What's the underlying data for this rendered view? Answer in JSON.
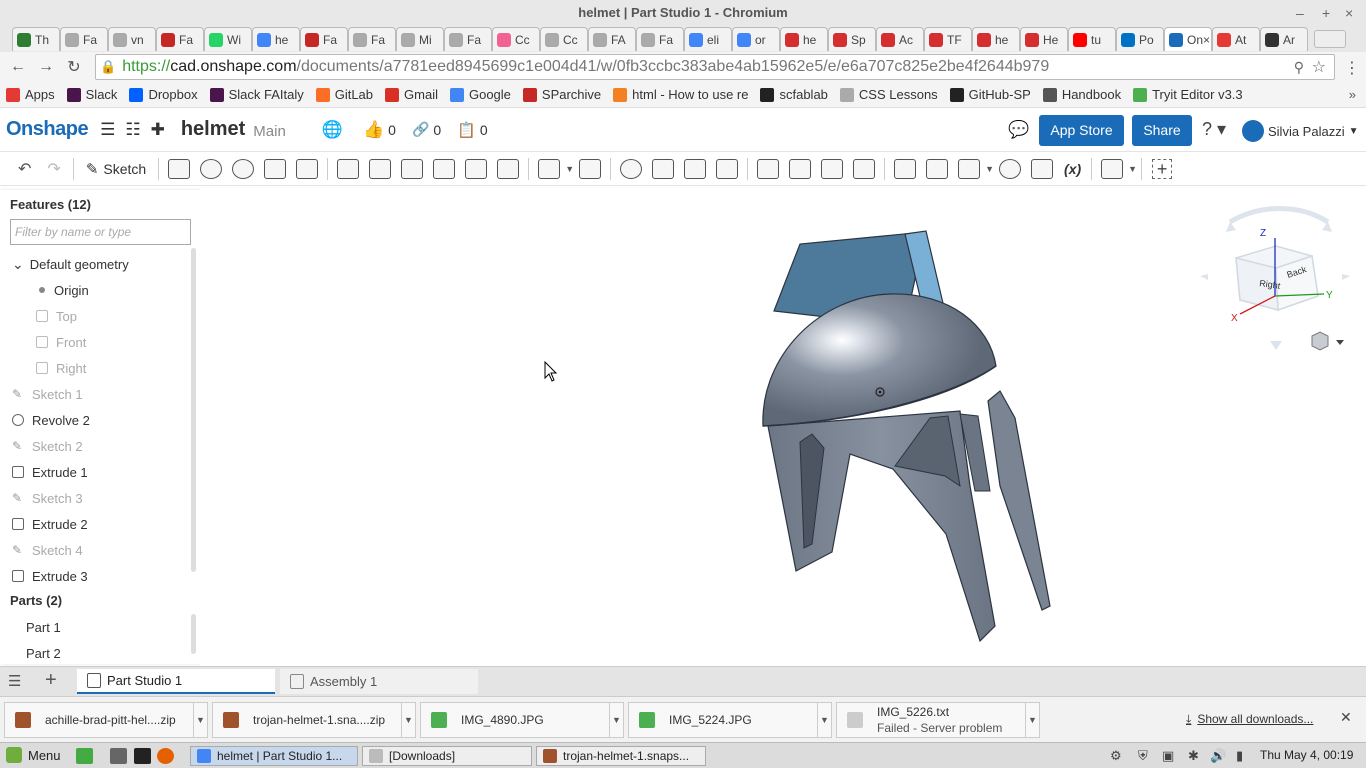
{
  "window": {
    "title": "helmet | Part Studio 1 - Chromium"
  },
  "browser": {
    "tabs": [
      {
        "label": "Th",
        "icon_color": "#2e7d32",
        "icon": "facebook-icon"
      },
      {
        "label": "Fa",
        "icon_color": "#aaaaaa",
        "icon": "page-icon"
      },
      {
        "label": "vn",
        "icon_color": "#aaaaaa",
        "icon": "page-icon"
      },
      {
        "label": "Fa",
        "icon_color": "#c62828",
        "icon": "fablab-icon"
      },
      {
        "label": "Wi",
        "icon_color": "#25d366",
        "icon": "whatsapp-icon"
      },
      {
        "label": "he",
        "icon_color": "#4285f4",
        "icon": "google-icon"
      },
      {
        "label": "Fa",
        "icon_color": "#c62828",
        "icon": "fablab-icon"
      },
      {
        "label": "Fa",
        "icon_color": "#aaaaaa",
        "icon": "page-icon"
      },
      {
        "label": "Mi",
        "icon_color": "#aaaaaa",
        "icon": "page-icon"
      },
      {
        "label": "Fa",
        "icon_color": "#aaaaaa",
        "icon": "page-icon"
      },
      {
        "label": "Cc",
        "icon_color": "#f06292",
        "icon": "dots-icon"
      },
      {
        "label": "Cc",
        "icon_color": "#aaaaaa",
        "icon": "page-icon"
      },
      {
        "label": "FA",
        "icon_color": "#aaaaaa",
        "icon": "page-icon"
      },
      {
        "label": "Fa",
        "icon_color": "#aaaaaa",
        "icon": "page-icon"
      },
      {
        "label": "eli",
        "icon_color": "#4285f4",
        "icon": "google-icon"
      },
      {
        "label": "or",
        "icon_color": "#4285f4",
        "icon": "google-icon"
      },
      {
        "label": "he",
        "icon_color": "#d32f2f",
        "icon": "gc-icon"
      },
      {
        "label": "Sp",
        "icon_color": "#d32f2f",
        "icon": "gc-icon"
      },
      {
        "label": "Ac",
        "icon_color": "#d32f2f",
        "icon": "gc-icon"
      },
      {
        "label": "TF",
        "icon_color": "#d32f2f",
        "icon": "gc-icon"
      },
      {
        "label": "he",
        "icon_color": "#d32f2f",
        "icon": "gc-icon"
      },
      {
        "label": "He",
        "icon_color": "#d32f2f",
        "icon": "gc-icon"
      },
      {
        "label": "tu",
        "icon_color": "#ff0000",
        "icon": "youtube-icon"
      },
      {
        "label": "Po",
        "icon_color": "#0072c6",
        "icon": "outlook-icon"
      },
      {
        "label": "On",
        "icon_color": "#1a6bb8",
        "icon": "onshape-icon",
        "active": true
      },
      {
        "label": "At",
        "icon_color": "#e53935",
        "icon": "tool-icon"
      },
      {
        "label": "Ar",
        "icon_color": "#333333",
        "icon": "amazon-icon"
      }
    ],
    "url": {
      "scheme": "https://",
      "host": "cad.onshape.com",
      "path": "/documents/a7781eed8945699c1e004d41/w/0fb3ccbc383abe4ab15962e5/e/e6a707c825e2be4f2644b979"
    },
    "bookmarks": [
      {
        "label": "Apps",
        "icon_color": "#e53935"
      },
      {
        "label": "Slack",
        "icon_color": "#4a154b"
      },
      {
        "label": "Dropbox",
        "icon_color": "#0061ff"
      },
      {
        "label": "Slack FAItaly",
        "icon_color": "#4a154b"
      },
      {
        "label": "GitLab",
        "icon_color": "#fc6d26"
      },
      {
        "label": "Gmail",
        "icon_color": "#d93025"
      },
      {
        "label": "Google",
        "icon_color": "#4285f4"
      },
      {
        "label": "SParchive",
        "icon_color": "#c62828"
      },
      {
        "label": "html - How to use re",
        "icon_color": "#f48024"
      },
      {
        "label": "scfablab",
        "icon_color": "#222222"
      },
      {
        "label": "CSS Lessons",
        "icon_color": "#aaaaaa"
      },
      {
        "label": "GitHub-SP",
        "icon_color": "#222222"
      },
      {
        "label": "Handbook",
        "icon_color": "#555555"
      },
      {
        "label": "Tryit Editor v3.3",
        "icon_color": "#4caf50"
      }
    ]
  },
  "app": {
    "logo": "Onshape",
    "doc_title": "helmet",
    "branch": "Main",
    "likes": "0",
    "links": "0",
    "copies": "0",
    "app_store_label": "App Store",
    "share_label": "Share",
    "user_name": "Silvia Palazzi",
    "accent": "#1a6bb8"
  },
  "toolbar": {
    "sketch_label": "Sketch",
    "variable_label": "(x)"
  },
  "features": {
    "title": "Features (12)",
    "filter_placeholder": "Filter by name or type",
    "items": [
      {
        "label": "Default geometry",
        "kind": "group",
        "dim": false
      },
      {
        "label": "Origin",
        "kind": "origin",
        "dim": false
      },
      {
        "label": "Top",
        "kind": "plane",
        "dim": true
      },
      {
        "label": "Front",
        "kind": "plane",
        "dim": true
      },
      {
        "label": "Right",
        "kind": "plane",
        "dim": true
      },
      {
        "label": "Sketch 1",
        "kind": "sketch",
        "dim": true
      },
      {
        "label": "Revolve 2",
        "kind": "revolve",
        "dim": false
      },
      {
        "label": "Sketch 2",
        "kind": "sketch",
        "dim": true
      },
      {
        "label": "Extrude 1",
        "kind": "extrude",
        "dim": false
      },
      {
        "label": "Sketch 3",
        "kind": "sketch",
        "dim": true
      },
      {
        "label": "Extrude 2",
        "kind": "extrude",
        "dim": false
      },
      {
        "label": "Sketch 4",
        "kind": "sketch",
        "dim": true
      },
      {
        "label": "Extrude 3",
        "kind": "extrude",
        "dim": false
      }
    ]
  },
  "parts": {
    "title": "Parts (2)",
    "items": [
      {
        "label": "Part 1"
      },
      {
        "label": "Part 2"
      }
    ]
  },
  "viewcube": {
    "z": "Z",
    "y": "Y",
    "x": "X",
    "right": "Right",
    "back": "Back"
  },
  "bottom_tabs": [
    {
      "label": "Part Studio 1",
      "active": true
    },
    {
      "label": "Assembly 1",
      "active": false
    }
  ],
  "downloads": {
    "items": [
      {
        "name": "achille-brad-pitt-hel....zip",
        "icon_color": "#a0522d",
        "status": ""
      },
      {
        "name": "trojan-helmet-1.sna....zip",
        "icon_color": "#a0522d",
        "status": ""
      },
      {
        "name": "IMG_4890.JPG",
        "icon_color": "#4caf50",
        "status": ""
      },
      {
        "name": "IMG_5224.JPG",
        "icon_color": "#4caf50",
        "status": ""
      },
      {
        "name": "IMG_5226.txt",
        "icon_color": "#cccccc",
        "status": "Failed - Server problem"
      }
    ],
    "show_all": "Show all downloads..."
  },
  "taskbar": {
    "menu_label": "Menu",
    "windows": [
      {
        "label": "helmet | Part Studio 1...",
        "icon_color": "#4285f4",
        "active": true
      },
      {
        "label": "[Downloads]",
        "icon_color": "#bbbbbb",
        "active": false
      },
      {
        "label": "trojan-helmet-1.snaps...",
        "icon_color": "#a0522d",
        "active": false
      }
    ],
    "clock": "Thu May  4, 00:19"
  }
}
